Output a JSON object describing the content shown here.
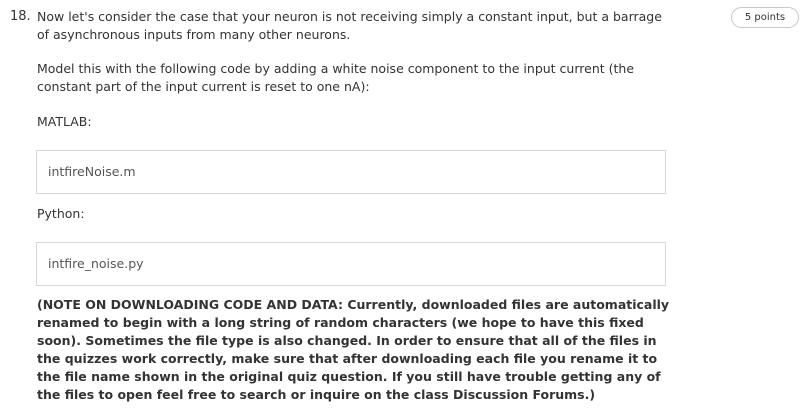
{
  "question": {
    "number": "18.",
    "points": "5 points",
    "prompt": "Now let's consider the case that your neuron is not receiving simply a constant input, but a barrage of asynchronous inputs from many other neurons.",
    "instruction": "Model this with the following code by adding a white noise component to the input current (the constant part of the input current is reset to one nA):",
    "matlab_label": "MATLAB:",
    "matlab_file": "intfireNoise.m",
    "python_label": "Python:",
    "python_file": "intfire_noise.py",
    "note": "(NOTE ON DOWNLOADING CODE AND DATA: Currently, downloaded files are automatically renamed to begin with a long string of random characters (we hope to have this fixed soon). Sometimes the file type is also changed. In order to ensure that all of the files in the quizzes work correctly, make sure that after downloading each file you rename it to the file name shown in the original quiz question. If you still have trouble getting any of the files to open feel free to search or inquire on the class Discussion Forums.)"
  }
}
